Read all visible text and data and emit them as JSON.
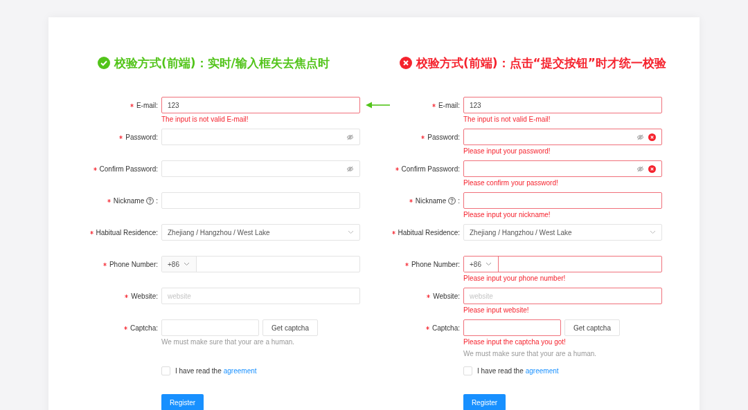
{
  "panels": [
    {
      "title": "校验方式(前端)：实时/输入框失去焦点时",
      "passed": true,
      "fields": [
        {
          "kind": "text",
          "label": "E-mail:",
          "required": true,
          "value": "123",
          "invalid": true,
          "error": "The input is not valid E-mail!"
        },
        {
          "kind": "password",
          "label": "Password:",
          "required": true,
          "invalid": false
        },
        {
          "kind": "password",
          "label": "Confirm Password:",
          "required": true,
          "invalid": false
        },
        {
          "kind": "text",
          "label": "Nickname",
          "hint_icon": true,
          "label_end": ":",
          "required": true,
          "invalid": false
        },
        {
          "kind": "select",
          "label": "Habitual Residence:",
          "required": true,
          "value": "Zhejiang / Hangzhou / West Lake",
          "invalid": false
        },
        {
          "kind": "phone",
          "label": "Phone Number:",
          "required": true,
          "prefix": "+86",
          "invalid": false
        },
        {
          "kind": "text",
          "label": "Website:",
          "required": true,
          "placeholder": "website",
          "invalid": false
        },
        {
          "kind": "captcha",
          "label": "Captcha:",
          "required": true,
          "button": "Get captcha",
          "help": "We must make sure that your are a human.",
          "invalid": false
        }
      ],
      "agreement": {
        "checked": false,
        "text": "I have read the",
        "link": "agreement"
      },
      "submit": "Register"
    },
    {
      "title": "校验方式(前端)：点击“提交按钮”时才统一校验",
      "passed": false,
      "fields": [
        {
          "kind": "text",
          "label": "E-mail:",
          "required": true,
          "value": "123",
          "invalid": true,
          "error": "The input is not valid E-mail!"
        },
        {
          "kind": "password",
          "label": "Password:",
          "required": true,
          "invalid": true,
          "error": "Please input your password!"
        },
        {
          "kind": "password",
          "label": "Confirm Password:",
          "required": true,
          "invalid": true,
          "error": "Please confirm your password!"
        },
        {
          "kind": "text",
          "label": "Nickname",
          "hint_icon": true,
          "label_end": ":",
          "required": true,
          "invalid": true,
          "error": "Please input your nickname!"
        },
        {
          "kind": "select",
          "label": "Habitual Residence:",
          "required": true,
          "value": "Zhejiang / Hangzhou / West Lake",
          "invalid": false
        },
        {
          "kind": "phone",
          "label": "Phone Number:",
          "required": true,
          "prefix": "+86",
          "invalid": true,
          "error": "Please input your phone number!"
        },
        {
          "kind": "text",
          "label": "Website:",
          "required": true,
          "placeholder": "website",
          "invalid": true,
          "error": "Please input website!"
        },
        {
          "kind": "captcha",
          "label": "Captcha:",
          "required": true,
          "button": "Get captcha",
          "help": "We must make sure that your are a human.",
          "invalid": true,
          "error": "Please input the captcha you got!"
        }
      ],
      "agreement": {
        "checked": false,
        "text": "I have read the",
        "link": "agreement"
      },
      "submit": "Register"
    }
  ]
}
